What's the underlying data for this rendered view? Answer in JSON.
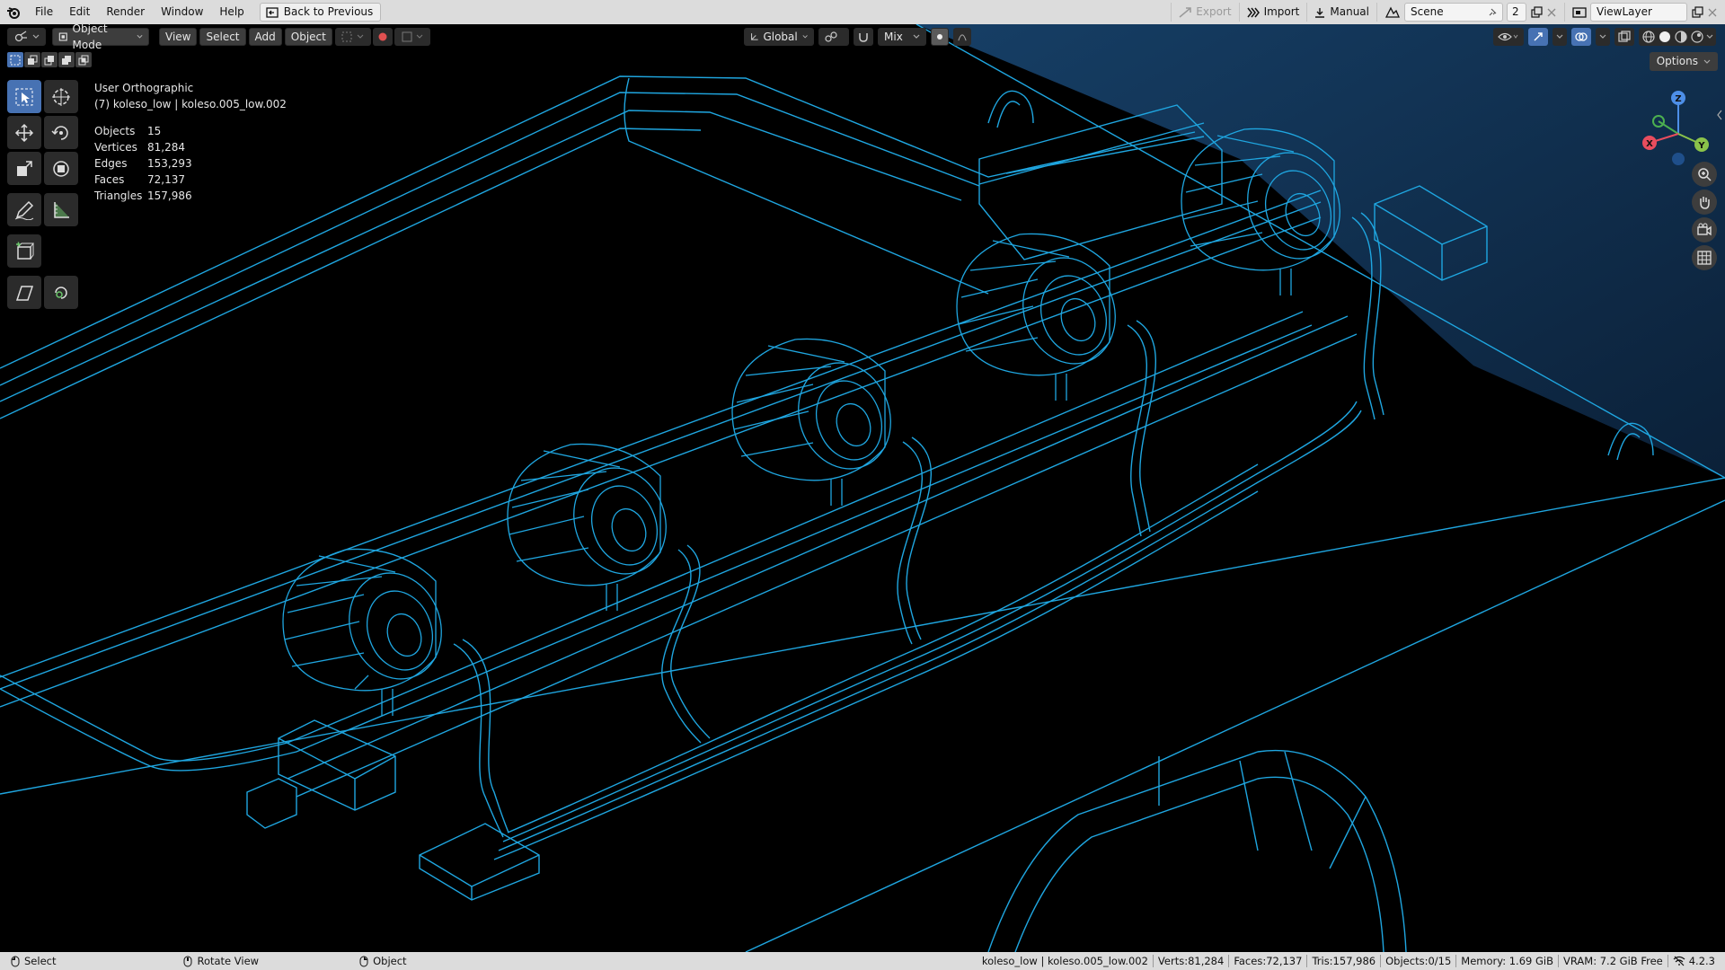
{
  "topbar": {
    "menus": [
      "File",
      "Edit",
      "Render",
      "Window",
      "Help"
    ],
    "back_button": "Back to Previous",
    "export_label": "Export",
    "import_label": "Import",
    "manual_label": "Manual",
    "scene_name": "Scene",
    "scene_users": "2",
    "view_layer": "ViewLayer"
  },
  "viewport_header": {
    "mode": "Object Mode",
    "menus": [
      "View",
      "Select",
      "Add",
      "Object"
    ],
    "transform_orientation": "Global",
    "snap_mode": "Mix"
  },
  "viewport_info": {
    "view_name": "User Orthographic",
    "object_path": "(7) koleso_low | koleso.005_low.002",
    "stats": [
      {
        "label": "Objects",
        "value": "15"
      },
      {
        "label": "Vertices",
        "value": "81,284"
      },
      {
        "label": "Edges",
        "value": "153,293"
      },
      {
        "label": "Faces",
        "value": "72,137"
      },
      {
        "label": "Triangles",
        "value": "157,986"
      }
    ]
  },
  "options_label": "Options",
  "gizmo": {
    "z": "Z",
    "x": "X",
    "y": "Y"
  },
  "statusbar": {
    "select_label": "Select",
    "rotate_label": "Rotate View",
    "object_label": "Object",
    "info": [
      "koleso_low | koleso.005_low.002",
      "Verts:81,284",
      "Faces:72,137",
      "Tris:157,986",
      "Objects:0/15",
      "Memory: 1.69 GiB",
      "VRAM: 7.2 GiB Free"
    ],
    "version": "4.2.3"
  },
  "colors": {
    "wire": "#1fa6e0",
    "wire_bright": "#2fb8f0",
    "accent": "#4772b3",
    "bar": "#dcdcdc"
  }
}
